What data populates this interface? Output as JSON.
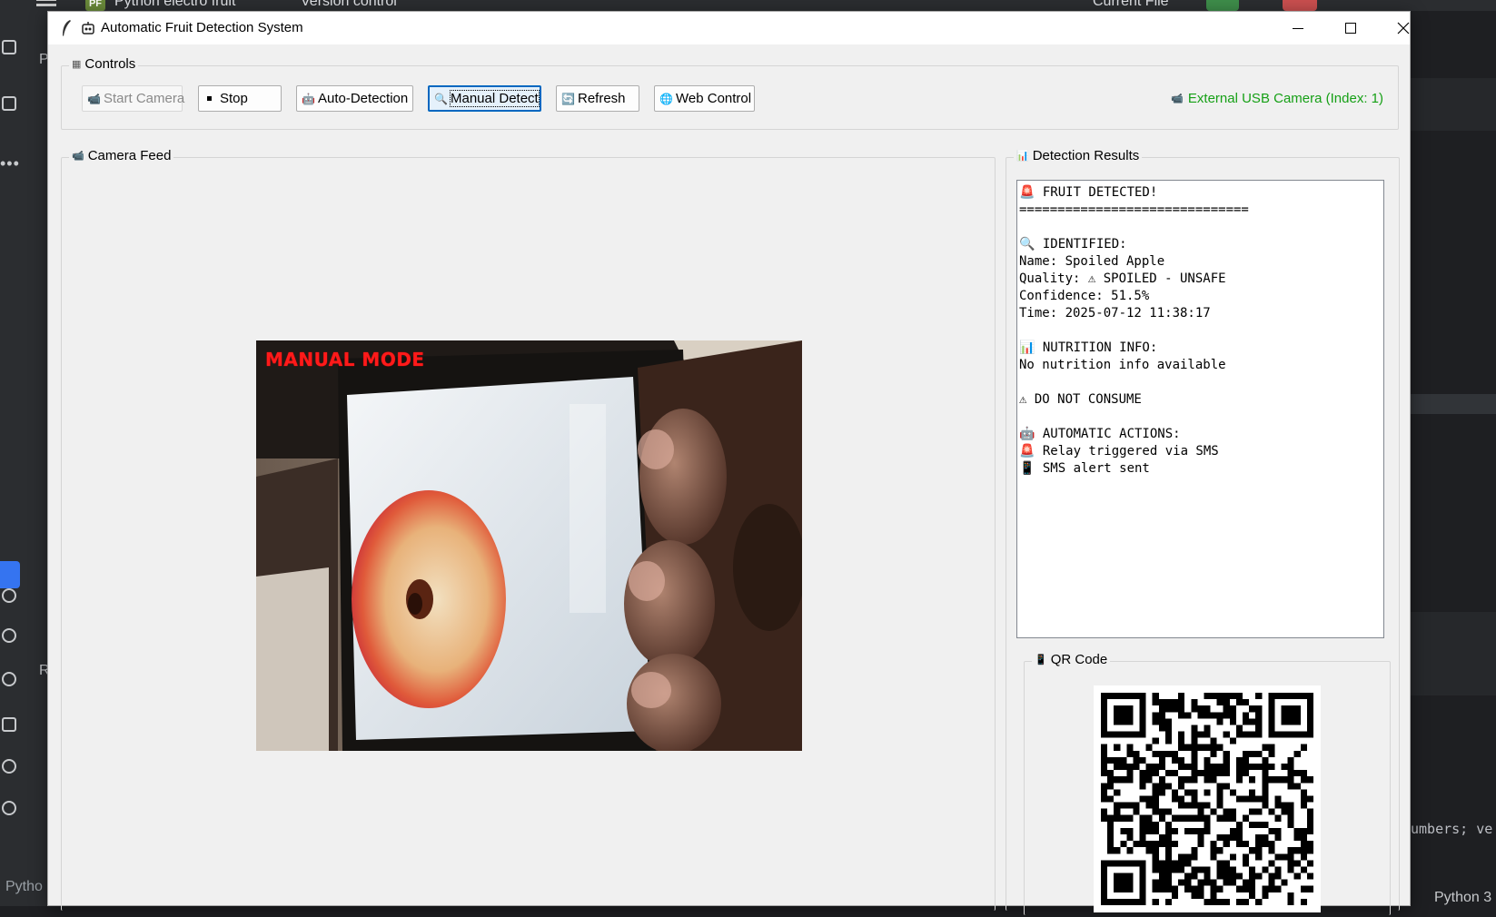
{
  "ide": {
    "project_badge": "PF",
    "project_name": "Python electro fruit",
    "version_control": "Version control",
    "run_config": "Current File",
    "left_letters": [
      "P",
      "R"
    ],
    "code_snippet": "umbers; ve",
    "status_interpreter": "Python 3",
    "status_left": "Pytho"
  },
  "window": {
    "title": "Automatic Fruit Detection System",
    "minimize": "—",
    "maximize": "☐",
    "close": "✕"
  },
  "controls": {
    "legend": "Controls",
    "legend_icon": "▦",
    "buttons": [
      {
        "icon": "📹",
        "label": "Start Camera",
        "state": "disabled"
      },
      {
        "icon": "⏹",
        "label": "Stop",
        "state": "normal"
      },
      {
        "icon": "🤖",
        "label": "Auto-Detection",
        "state": "normal"
      },
      {
        "icon": "🔍",
        "label": "Manual Detect",
        "state": "focused"
      },
      {
        "icon": "🔄",
        "label": "Refresh",
        "state": "normal"
      },
      {
        "icon": "🌐",
        "label": "Web Control",
        "state": "normal"
      }
    ],
    "camera_status_icon": "📹",
    "camera_status": "External USB Camera (Index: 1)",
    "camera_status_color": "#16a016"
  },
  "camera_feed": {
    "legend": "Camera Feed",
    "legend_icon": "📹",
    "overlay_text": "MANUAL MODE",
    "overlay_color": "#ff1a1a"
  },
  "results": {
    "legend": "Detection Results",
    "legend_icon": "📊",
    "lines": [
      "🚨 FRUIT DETECTED!",
      "==============================",
      "",
      "🔍 IDENTIFIED:",
      "Name: Spoiled Apple",
      "Quality: ⚠ SPOILED - UNSAFE",
      "Confidence: 51.5%",
      "Time: 2025-07-12 11:38:17",
      "",
      "📊 NUTRITION INFO:",
      "No nutrition info available",
      "",
      "⚠ DO NOT CONSUME",
      "",
      "🤖 AUTOMATIC ACTIONS:",
      "🚨 Relay triggered via SMS",
      "📱 SMS alert sent"
    ]
  },
  "qr": {
    "legend": "QR Code",
    "legend_icon": "📱"
  }
}
